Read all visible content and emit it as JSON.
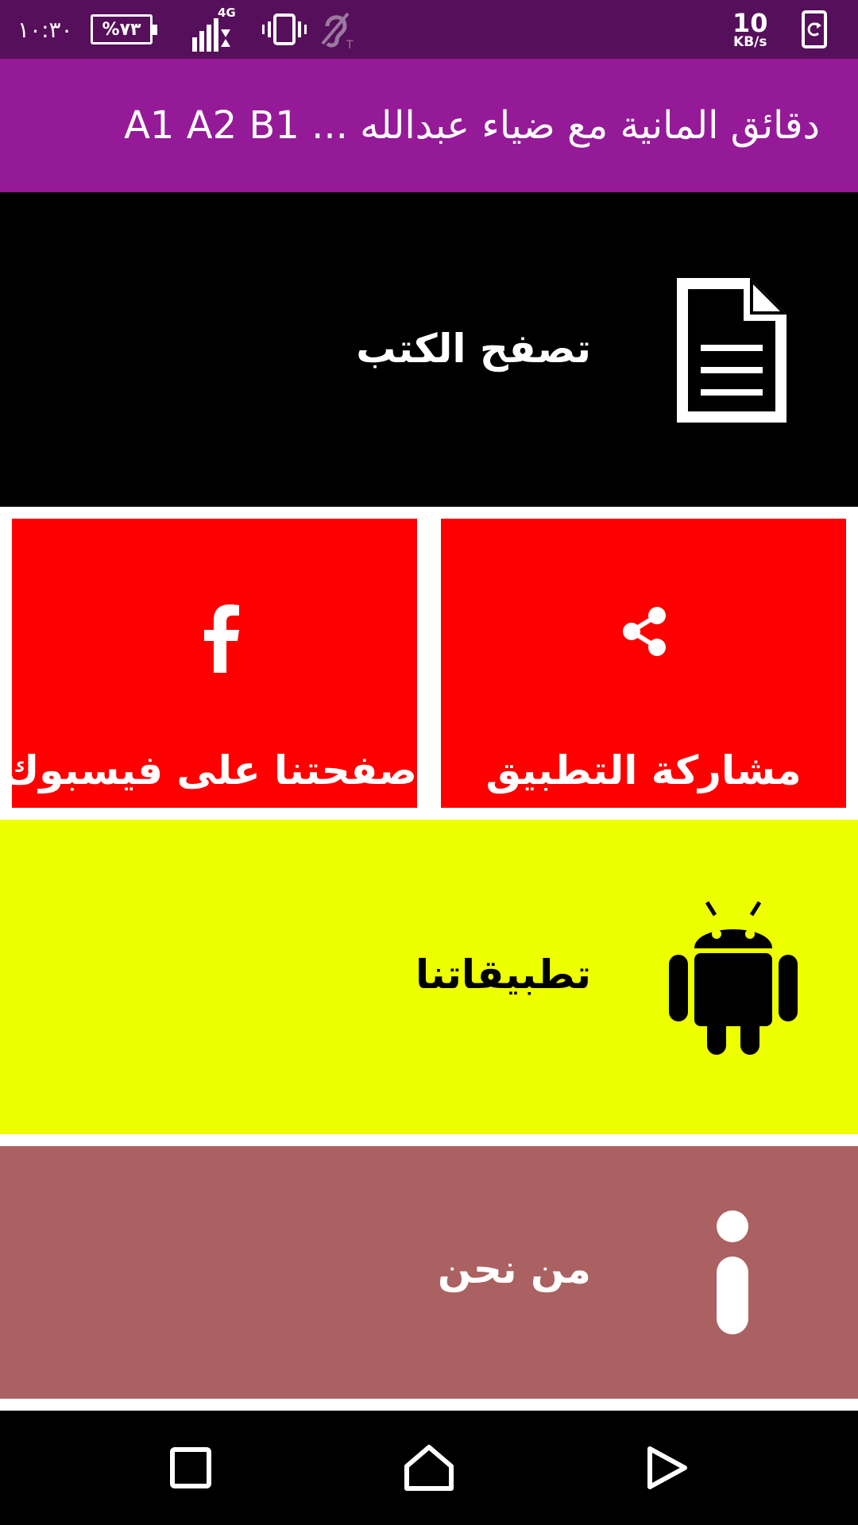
{
  "status_bar": {
    "time": "١٠:٣٠",
    "battery": "%٧٣",
    "network_type": "4G",
    "speed_value": "10",
    "speed_unit": "KB/s",
    "background_color": "#560f5a"
  },
  "app_bar": {
    "title": "دقائق المانية مع ضياء عبدالله ... A1 A2 B1",
    "background_color": "#951a98"
  },
  "tiles": {
    "books": {
      "label": "تصفح الكتب",
      "icon": "document-icon",
      "color": "#000000"
    },
    "share": {
      "label": "مشاركة التطبيق",
      "icon": "share-icon",
      "color": "#fe0000"
    },
    "facebook": {
      "label": "صفحتنا على فيسبوك",
      "icon": "facebook-icon",
      "color": "#fe0000"
    },
    "apps": {
      "label": "تطبيقاتنا",
      "icon": "android-icon",
      "color": "#eeff00"
    },
    "about": {
      "label": "من نحن",
      "icon": "info-icon",
      "color": "#ab6161"
    }
  },
  "nav_bar": {
    "buttons": [
      "recent-apps",
      "home",
      "back"
    ]
  }
}
